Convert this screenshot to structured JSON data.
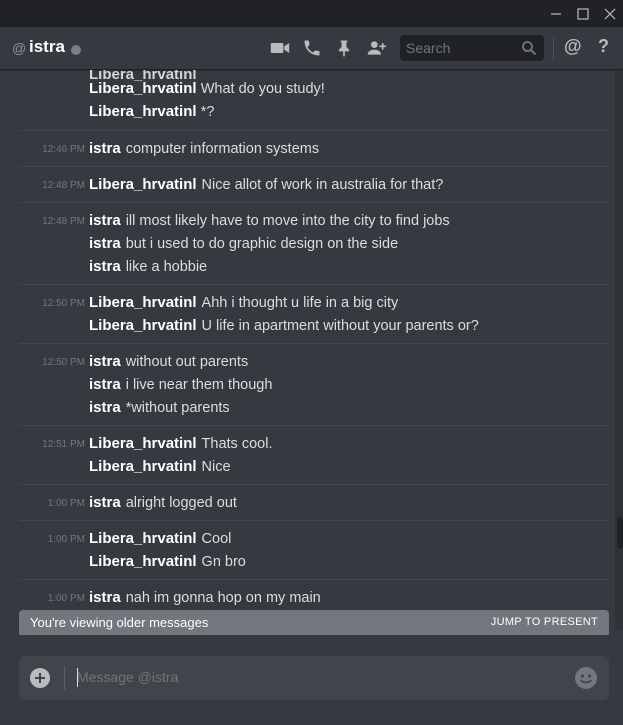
{
  "window": {
    "controls": [
      "minimize-icon",
      "maximize-icon",
      "close-icon"
    ]
  },
  "header": {
    "at_symbol": "@",
    "title": "istra",
    "status": "offline",
    "icons": [
      "video-call-icon",
      "voice-call-icon",
      "pin-icon",
      "add-friend-icon"
    ],
    "search_placeholder": "Search",
    "mention_symbol": "@",
    "help_symbol": "?"
  },
  "messages": {
    "partial_top": [
      {
        "author": "Libera_hrvatinl",
        "text": "What do you study!"
      },
      {
        "author": "Libera_hrvatinl",
        "text": "*?"
      }
    ],
    "groups": [
      {
        "time": "12:46 PM",
        "lines": [
          {
            "author": "istra",
            "text": "computer information systems"
          }
        ]
      },
      {
        "time": "12:48 PM",
        "lines": [
          {
            "author": "Libera_hrvatinl",
            "text": "Nice allot of work in australia for that?"
          }
        ]
      },
      {
        "time": "12:48 PM",
        "lines": [
          {
            "author": "istra",
            "text": "ill most likely have to move into the city to find jobs"
          },
          {
            "author": "istra",
            "text": "but i used to do graphic design on the side"
          },
          {
            "author": "istra",
            "text": "like a hobbie"
          }
        ]
      },
      {
        "time": "12:50 PM",
        "lines": [
          {
            "author": "Libera_hrvatinl",
            "text": "Ahh i thought u life in a big city"
          },
          {
            "author": "Libera_hrvatinl",
            "text": "U life in apartment without your parents or?"
          }
        ]
      },
      {
        "time": "12:50 PM",
        "lines": [
          {
            "author": "istra",
            "text": "without out parents"
          },
          {
            "author": "istra",
            "text": "i live near them though"
          },
          {
            "author": "istra",
            "text": "*without parents"
          }
        ]
      },
      {
        "time": "12:51 PM",
        "lines": [
          {
            "author": "Libera_hrvatinl",
            "text": "Thats cool."
          },
          {
            "author": "Libera_hrvatinl",
            "text": "Nice"
          }
        ]
      },
      {
        "time": "1:00 PM",
        "lines": [
          {
            "author": "istra",
            "text": "alright logged out"
          }
        ]
      },
      {
        "time": "1:00 PM",
        "lines": [
          {
            "author": "Libera_hrvatinl",
            "text": "Cool"
          },
          {
            "author": "Libera_hrvatinl",
            "text": "Gn bro"
          }
        ]
      },
      {
        "time": "1:00 PM",
        "lines": [
          {
            "author": "istra",
            "text": "nah im gonna hop on my main"
          }
        ]
      }
    ]
  },
  "older_bar": {
    "text": "You're viewing older messages",
    "jump": "JUMP TO PRESENT"
  },
  "composer": {
    "placeholder": "Message @istra",
    "icons": [
      "add-attachment-icon",
      "emoji-icon"
    ]
  },
  "colors": {
    "background": "#36393f",
    "titlebar": "#202225",
    "older_bar": "#72767d",
    "composer": "#40444b"
  }
}
